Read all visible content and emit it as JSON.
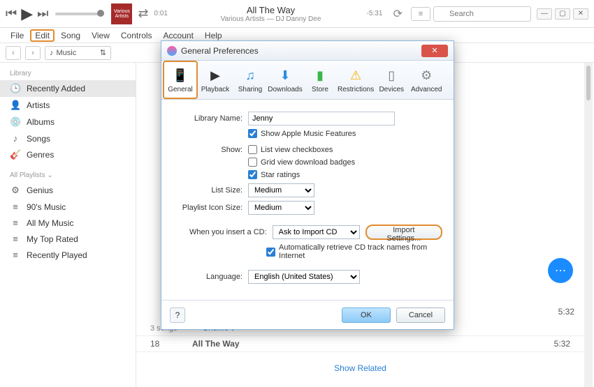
{
  "player": {
    "album_art_text": "Various Artists",
    "track_title": "All The Way",
    "track_artist": "Various Artists — DJ Danny Dee",
    "time_elapsed": "0:01",
    "time_remaining": "-5:31"
  },
  "search": {
    "placeholder": "Search"
  },
  "menu": {
    "file": "File",
    "edit": "Edit",
    "song": "Song",
    "view": "View",
    "controls": "Controls",
    "account": "Account",
    "help": "Help"
  },
  "nav": {
    "music_label": "Music"
  },
  "sidebar": {
    "library_header": "Library",
    "items": [
      {
        "icon": "🕒",
        "label": "Recently Added"
      },
      {
        "icon": "👤",
        "label": "Artists"
      },
      {
        "icon": "💿",
        "label": "Albums"
      },
      {
        "icon": "♪",
        "label": "Songs"
      },
      {
        "icon": "🎸",
        "label": "Genres"
      }
    ],
    "playlists_header": "All Playlists ⌄",
    "playlists": [
      {
        "icon": "⚙",
        "label": "Genius"
      },
      {
        "icon": "≡",
        "label": "90's Music"
      },
      {
        "icon": "≡",
        "label": "All My Music"
      },
      {
        "icon": "≡",
        "label": "My Top Rated"
      },
      {
        "icon": "≡",
        "label": "Recently Played"
      }
    ]
  },
  "content": {
    "songs_count": "3 songs",
    "shuffle": "Shuffle ⇄",
    "track_num": "18",
    "track_name": "All The Way",
    "track_dur_a": "5:32",
    "track_dur_b": "5:32",
    "show_related": "Show Related"
  },
  "dialog": {
    "title": "General Preferences",
    "tabs": {
      "general": "General",
      "playback": "Playback",
      "sharing": "Sharing",
      "downloads": "Downloads",
      "store": "Store",
      "restrictions": "Restrictions",
      "devices": "Devices",
      "advanced": "Advanced"
    },
    "library_name_label": "Library Name:",
    "library_name_value": "Jenny",
    "show_apple_music": "Show Apple Music Features",
    "show_label": "Show:",
    "list_view_checkboxes": "List view checkboxes",
    "grid_view_badges": "Grid view download badges",
    "star_ratings": "Star ratings",
    "list_size_label": "List Size:",
    "list_size_value": "Medium",
    "icon_size_label": "Playlist Icon Size:",
    "icon_size_value": "Medium",
    "cd_label": "When you insert a CD:",
    "cd_value": "Ask to Import CD",
    "import_settings": "Import Settings...",
    "auto_retrieve": "Automatically retrieve CD track names from Internet",
    "language_label": "Language:",
    "language_value": "English (United States)",
    "help": "?",
    "ok": "OK",
    "cancel": "Cancel"
  }
}
